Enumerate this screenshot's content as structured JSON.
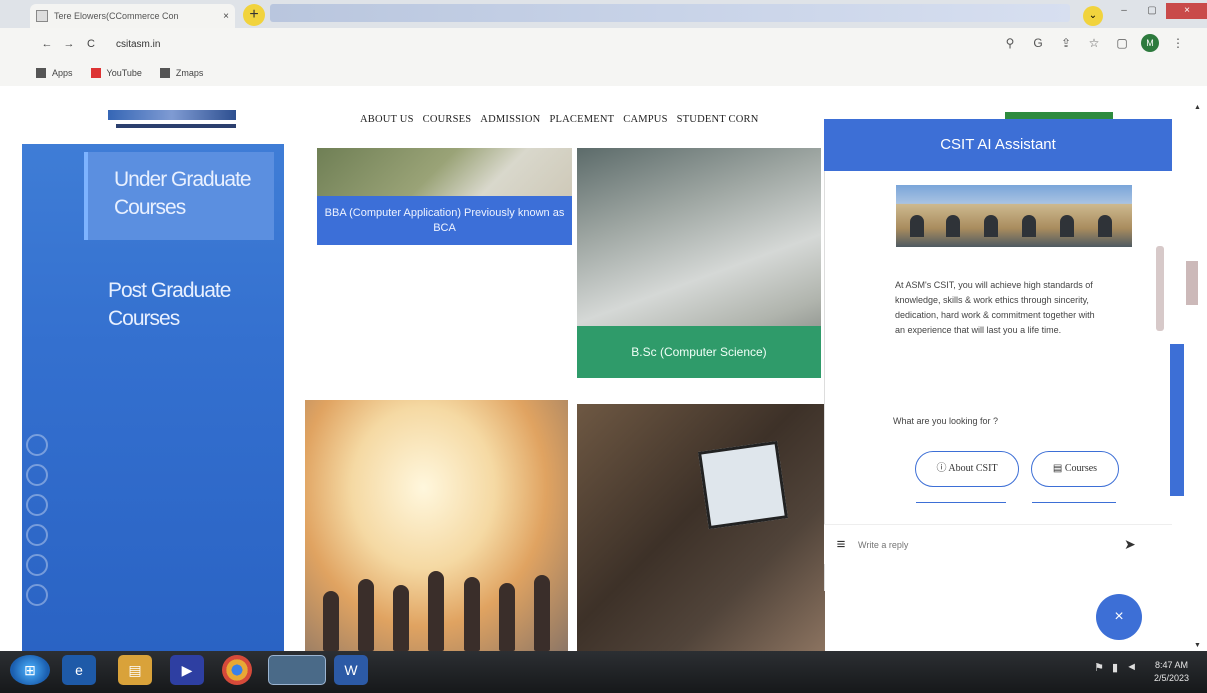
{
  "browser": {
    "tab_title": "Tere Elowers(CCommerce Con",
    "tab_close": "×",
    "new_tab": "+",
    "tab_search": "⌄",
    "window_controls": [
      "–",
      "▢",
      "×"
    ],
    "url": "csitasm.in",
    "back": "←",
    "forward": "→",
    "reload": "C",
    "toolbar_icons": [
      "lock-icon",
      "google-icon",
      "share-icon",
      "star-icon",
      "extension-icon",
      "profile-icon",
      "menu-icon"
    ],
    "profile_initial": "M",
    "bookmarks": [
      "Apps",
      "YouTube",
      "Zmaps"
    ]
  },
  "site": {
    "nav": [
      "ABOUT US",
      "COURSES",
      "ADMISSION",
      "PLACEMENT",
      "CAMPUS",
      "STUDENT CORN"
    ],
    "sidebar": {
      "item_1": "Under Graduate Courses",
      "item_2": "Post Graduate Courses"
    },
    "courses": {
      "bba_caption": "BBA (Computer Application) Previously known as BCA",
      "bsc_caption": "B.Sc (Computer Science)"
    }
  },
  "chat": {
    "title": "CSIT AI Assistant",
    "message": "At ASM's CSIT, you will achieve high standards of knowledge, skills & work ethics through sincerity, dedication, hard work & commitment together with an experience that will last you a life time.",
    "question": "What are you looking for ?",
    "chips": {
      "about": "ⓘ About CSIT",
      "courses": "▤ Courses"
    },
    "input_placeholder": "Write a reply",
    "send_icon": "➤",
    "menu_icon": "≡",
    "close_label": "×"
  },
  "taskbar": {
    "time": "8:47 AM",
    "date": "2/5/2023"
  },
  "colors": {
    "accent_blue": "#3d6fd6",
    "sidebar_blue": "#3470cf",
    "bsc_green": "#2f9b6a",
    "nav_green": "#2e8b3e"
  }
}
